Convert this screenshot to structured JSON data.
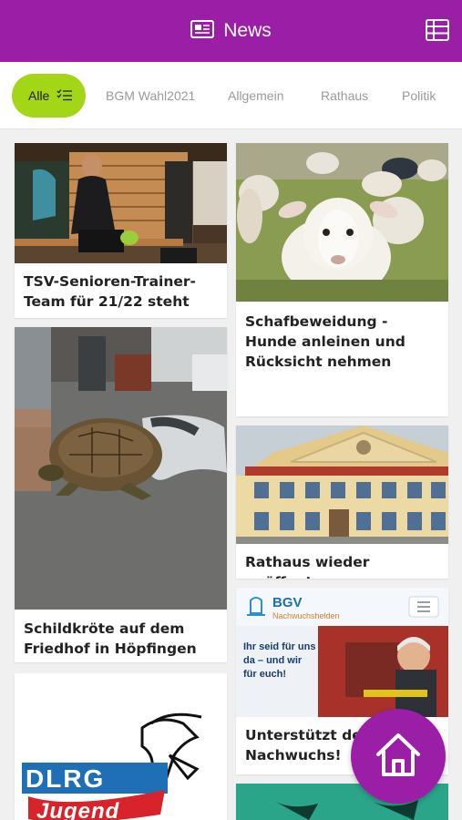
{
  "header": {
    "title": "News",
    "news_icon": "newspaper-icon",
    "menu_icon": "table-list-icon",
    "color": "#9b1fa6"
  },
  "tabs": [
    {
      "label": "Alle",
      "active": true,
      "icon": "checklist-icon"
    },
    {
      "label": "BGM Wahl2021",
      "active": false
    },
    {
      "label": "Allgemein",
      "active": false
    },
    {
      "label": "Rathaus",
      "active": false
    },
    {
      "label": "Politik",
      "active": false
    }
  ],
  "accent": "#a4d618",
  "articles": [
    {
      "title": "TSV-Senioren-Trainer-Team für 21/22 steht",
      "image": "man-in-locker-room-photo"
    },
    {
      "title": "Schafbeweidung - Hunde anleinen und Rücksicht nehmen",
      "image": "sheep-photo"
    },
    {
      "title": "Schildkröte auf dem Friedhof in Höpfingen",
      "image": "turtle-photo"
    },
    {
      "title": "Rathaus wieder geöffnet",
      "image": "town-hall-photo"
    },
    {
      "title": "Unterstützt de Nachwuchs!",
      "image": "bgv-ad-photo",
      "ad": {
        "brand": "BGV",
        "sub": "Nachwuchshelden",
        "slogan": "Ihr seid für uns da – und wir für euch!"
      }
    },
    {
      "title": "",
      "image": "dlrg-jugend-logo",
      "logo_text": [
        "DLRG",
        "Jugend"
      ]
    }
  ],
  "fab": {
    "icon": "home-icon"
  }
}
